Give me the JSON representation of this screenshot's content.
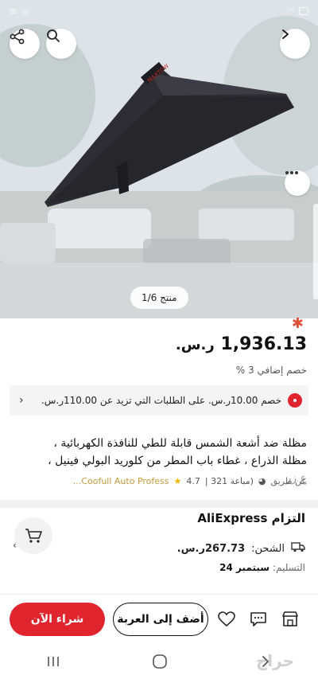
{
  "status_bar": {
    "time": ""
  },
  "hero": {
    "image_counter": "منتج 1/6",
    "awning_brand": "MAXTOW"
  },
  "product": {
    "price_value": "1,936.13",
    "price_currency": "ر.س.",
    "extra_discount": "خصم إضافي 3 %",
    "coupon_text": "خصم 10.00ر.س. على الطلبات التي تزيد عن 110.00ر.س.",
    "title_line1": "مظلة ضد أشعة الشمس قابلة للطي للنافذة الكهربائية ،",
    "title_line2": "مظلة الذراع ، غطاء باب المطر من كلوريد البولي فينيل ،",
    "title_line3": "ع زر",
    "store_by": "عن طريق",
    "store_name": "Coofull Auto Profess...",
    "rating": "4.7",
    "sold": "(مباعة 321 |",
    "bluetooth_glyph": "✱"
  },
  "commitment": {
    "title": "التزام AliExpress",
    "shipping_label": "الشحن:",
    "shipping_value": "267.73ر.س.",
    "delivery_label": "التسليم:",
    "delivery_date": "سبتمبر 24"
  },
  "actions": {
    "buy_now": "شراء الآن",
    "add_to_cart": "أضف إلى العربة"
  },
  "watermark": "حراج"
}
